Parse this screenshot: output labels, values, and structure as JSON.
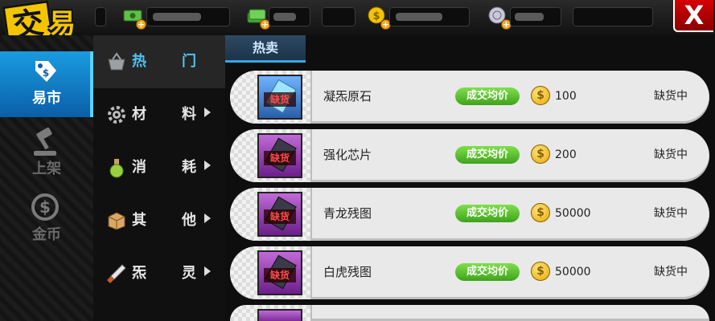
{
  "title": {
    "char1": "交",
    "char2": "易"
  },
  "close": {
    "label": "X"
  },
  "currencies": [
    {
      "icon": "cash-icon",
      "color": "#5fbf4a"
    },
    {
      "icon": "cash-stack-icon",
      "color": "#5fbf4a"
    },
    {
      "icon": "gold-coin-icon",
      "color": "#f2c500"
    },
    {
      "icon": "silver-coin-icon",
      "color": "#c8c8d8"
    }
  ],
  "left_nav": [
    {
      "icon": "price-tag-icon",
      "label": "易市",
      "active": true
    },
    {
      "icon": "gavel-icon",
      "label": "上架",
      "active": false
    },
    {
      "icon": "dollar-coin-icon",
      "label": "金币",
      "active": false
    }
  ],
  "categories": [
    {
      "icon": "basket-icon",
      "t1": "热",
      "t2": "门",
      "active": true
    },
    {
      "icon": "gear-icon",
      "t1": "材",
      "t2": "料",
      "active": false
    },
    {
      "icon": "potion-icon",
      "t1": "消",
      "t2": "耗",
      "active": false
    },
    {
      "icon": "box-icon",
      "t1": "其",
      "t2": "他",
      "active": false
    },
    {
      "icon": "dagger-icon",
      "t1": "炁",
      "t2": "灵",
      "active": false
    }
  ],
  "tab": {
    "label": "热卖"
  },
  "items": [
    {
      "name": "凝炁原石",
      "thumb": "blue",
      "badge": "缺货",
      "avg_label": "成交均价",
      "price": "100",
      "status": "缺货中"
    },
    {
      "name": "强化芯片",
      "thumb": "purple",
      "badge": "缺货",
      "avg_label": "成交均价",
      "price": "200",
      "status": "缺货中"
    },
    {
      "name": "青龙残图",
      "thumb": "purple",
      "badge": "缺货",
      "avg_label": "成交均价",
      "price": "50000",
      "status": "缺货中"
    },
    {
      "name": "白虎残图",
      "thumb": "purple",
      "badge": "缺货",
      "avg_label": "成交均价",
      "price": "50000",
      "status": "缺货中"
    },
    {
      "name": "",
      "thumb": "purple",
      "badge": "",
      "avg_label": "",
      "price": "",
      "status": ""
    }
  ]
}
